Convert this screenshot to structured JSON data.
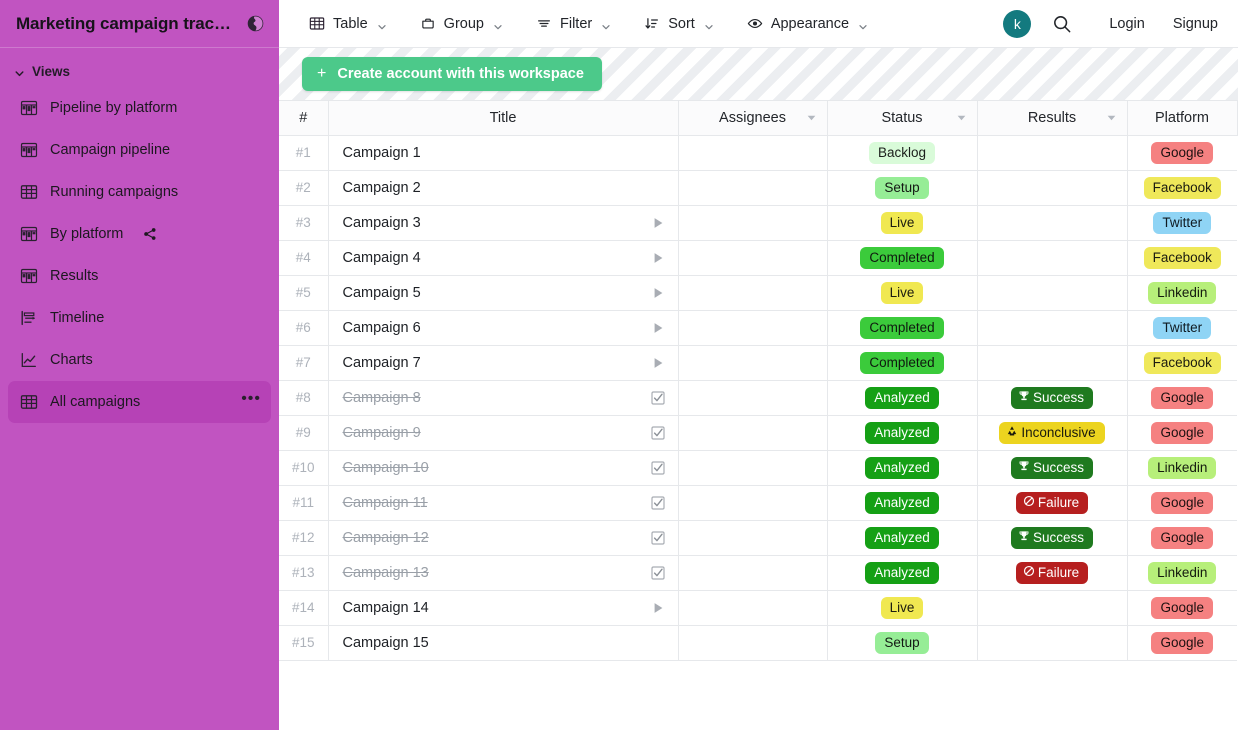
{
  "sidebar": {
    "workspace_title": "Marketing campaign trac…",
    "globe_icon": "globe-icon",
    "section_label": "Views",
    "section_chevron": "chevron-down-icon",
    "items": [
      {
        "label": "Pipeline by platform",
        "icon": "kanban-board-icon",
        "selected": false,
        "shared": false,
        "menu": false
      },
      {
        "label": "Campaign pipeline",
        "icon": "kanban-board-icon",
        "selected": false,
        "shared": false,
        "menu": false
      },
      {
        "label": "Running campaigns",
        "icon": "table-grid-icon",
        "selected": false,
        "shared": false,
        "menu": false
      },
      {
        "label": "By platform",
        "icon": "kanban-board-icon",
        "selected": false,
        "shared": true,
        "share_icon": "share-icon",
        "menu": false
      },
      {
        "label": "Results",
        "icon": "kanban-board-icon",
        "selected": false,
        "shared": false,
        "menu": false
      },
      {
        "label": "Timeline",
        "icon": "timeline-gantt-icon",
        "selected": false,
        "shared": false,
        "menu": false
      },
      {
        "label": "Charts",
        "icon": "line-chart-icon",
        "selected": false,
        "shared": false,
        "menu": false
      },
      {
        "label": "All campaigns",
        "icon": "table-grid-icon",
        "selected": true,
        "shared": false,
        "menu": true,
        "menu_label": "•••"
      }
    ]
  },
  "toolbar": {
    "buttons": [
      {
        "label": "Table",
        "icon": "table-grid-icon",
        "caret": "chevron-down-icon"
      },
      {
        "label": "Group",
        "icon": "group-basket-icon",
        "caret": "chevron-down-icon"
      },
      {
        "label": "Filter",
        "icon": "filter-lines-icon",
        "caret": "chevron-down-icon"
      },
      {
        "label": "Sort",
        "icon": "sort-arrow-icon",
        "caret": "chevron-down-icon"
      },
      {
        "label": "Appearance",
        "icon": "eye-icon",
        "caret": "chevron-down-icon"
      }
    ],
    "avatar_initial": "k",
    "avatar_color": "#137a7f",
    "search_icon": "search-icon",
    "login_label": "Login",
    "signup_label": "Signup"
  },
  "banner": {
    "button_label": "Create account with this workspace",
    "button_icon": "plus-icon",
    "button_color": "#4cc98a"
  },
  "table": {
    "columns": [
      {
        "key": "num",
        "label": "#",
        "caret": false
      },
      {
        "key": "title",
        "label": "Title",
        "caret": false
      },
      {
        "key": "assignees",
        "label": "Assignees",
        "caret": true
      },
      {
        "key": "status",
        "label": "Status",
        "caret": true
      },
      {
        "key": "results",
        "label": "Results",
        "caret": true
      },
      {
        "key": "platform",
        "label": "Platform",
        "caret": false
      }
    ],
    "status_colors": {
      "Backlog": {
        "bg": "#d9fbd9",
        "fg": "#1b1f1b"
      },
      "Setup": {
        "bg": "#96ed96",
        "fg": "#141814"
      },
      "Live": {
        "bg": "#f0e851",
        "fg": "#1b1b10"
      },
      "Completed": {
        "bg": "#3bcb3b",
        "fg": "#0f1a0f"
      },
      "Analyzed": {
        "bg": "#15a015",
        "fg": "#ffffff"
      }
    },
    "result_colors": {
      "Success": {
        "bg": "#1f7a1f",
        "fg": "#ffffff",
        "icon": "trophy-icon",
        "glyph": "🏆"
      },
      "Inconclusive": {
        "bg": "#ecd41f",
        "fg": "#1a1a0d",
        "icon": "recycle-icon",
        "glyph": "♻"
      },
      "Failure": {
        "bg": "#b61f1f",
        "fg": "#ffffff",
        "icon": "prohibited-icon",
        "glyph": "⊘"
      }
    },
    "platform_colors": {
      "Google": {
        "bg": "#f58181",
        "fg": "#1c1010"
      },
      "Facebook": {
        "bg": "#efe85a",
        "fg": "#1b1b10"
      },
      "Twitter": {
        "bg": "#8fd4f5",
        "fg": "#0f1a21"
      },
      "Linkedin": {
        "bg": "#b7ef7a",
        "fg": "#141b0e"
      }
    },
    "rows": [
      {
        "num": "#1",
        "title": "Campaign 1",
        "done": false,
        "state_icon": "",
        "assignees": "",
        "status": "Backlog",
        "results": "",
        "platform": "Google"
      },
      {
        "num": "#2",
        "title": "Campaign 2",
        "done": false,
        "state_icon": "",
        "assignees": "",
        "status": "Setup",
        "results": "",
        "platform": "Facebook"
      },
      {
        "num": "#3",
        "title": "Campaign 3",
        "done": false,
        "state_icon": "play-icon",
        "assignees": "",
        "status": "Live",
        "results": "",
        "platform": "Twitter"
      },
      {
        "num": "#4",
        "title": "Campaign 4",
        "done": false,
        "state_icon": "play-icon",
        "assignees": "",
        "status": "Completed",
        "results": "",
        "platform": "Facebook"
      },
      {
        "num": "#5",
        "title": "Campaign 5",
        "done": false,
        "state_icon": "play-icon",
        "assignees": "",
        "status": "Live",
        "results": "",
        "platform": "Linkedin"
      },
      {
        "num": "#6",
        "title": "Campaign 6",
        "done": false,
        "state_icon": "play-icon",
        "assignees": "",
        "status": "Completed",
        "results": "",
        "platform": "Twitter"
      },
      {
        "num": "#7",
        "title": "Campaign 7",
        "done": false,
        "state_icon": "play-icon",
        "assignees": "",
        "status": "Completed",
        "results": "",
        "platform": "Facebook"
      },
      {
        "num": "#8",
        "title": "Campaign 8",
        "done": true,
        "state_icon": "checkbox-checked-icon",
        "assignees": "",
        "status": "Analyzed",
        "results": "Success",
        "platform": "Google"
      },
      {
        "num": "#9",
        "title": "Campaign 9",
        "done": true,
        "state_icon": "checkbox-checked-icon",
        "assignees": "",
        "status": "Analyzed",
        "results": "Inconclusive",
        "platform": "Google"
      },
      {
        "num": "#10",
        "title": "Campaign 10",
        "done": true,
        "state_icon": "checkbox-checked-icon",
        "assignees": "",
        "status": "Analyzed",
        "results": "Success",
        "platform": "Linkedin"
      },
      {
        "num": "#11",
        "title": "Campaign 11",
        "done": true,
        "state_icon": "checkbox-checked-icon",
        "assignees": "",
        "status": "Analyzed",
        "results": "Failure",
        "platform": "Google"
      },
      {
        "num": "#12",
        "title": "Campaign 12",
        "done": true,
        "state_icon": "checkbox-checked-icon",
        "assignees": "",
        "status": "Analyzed",
        "results": "Success",
        "platform": "Google"
      },
      {
        "num": "#13",
        "title": "Campaign 13",
        "done": true,
        "state_icon": "checkbox-checked-icon",
        "assignees": "",
        "status": "Analyzed",
        "results": "Failure",
        "platform": "Linkedin"
      },
      {
        "num": "#14",
        "title": "Campaign 14",
        "done": false,
        "state_icon": "play-icon",
        "assignees": "",
        "status": "Live",
        "results": "",
        "platform": "Google"
      },
      {
        "num": "#15",
        "title": "Campaign 15",
        "done": false,
        "state_icon": "",
        "assignees": "",
        "status": "Setup",
        "results": "",
        "platform": "Google"
      }
    ]
  }
}
